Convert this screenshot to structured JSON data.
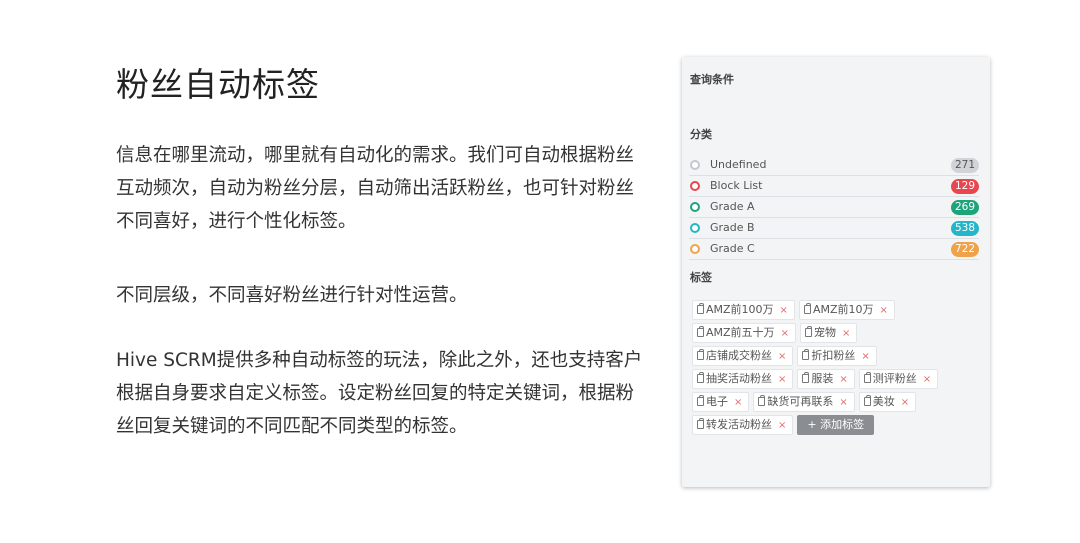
{
  "heading": "粉丝自动标签",
  "paragraphs": [
    "信息在哪里流动，哪里就有自动化的需求。我们可自动根据粉丝互动频次，自动为粉丝分层，自动筛出活跃粉丝，也可针对粉丝不同喜好，进行个性化标签。",
    "不同层级，不同喜好粉丝进行针对性运营。",
    "Hive SCRM提供多种自动标签的玩法，除此之外，还也支持客户根据自身要求自定义标签。设定粉丝回复的特定关键词，根据粉丝回复关键词的不同匹配不同类型的标签。"
  ],
  "panel": {
    "title": "查询条件",
    "category_title": "分类",
    "tags_title": "标签",
    "categories": [
      {
        "label": "Undefined",
        "count": "271",
        "color": "#d0d3d7",
        "icon_color": "#c4c8cc",
        "text_color": "#555555"
      },
      {
        "label": "Block List",
        "count": "129",
        "color": "#e8474f",
        "icon_color": "#e8474f",
        "text_color": "#ffffff"
      },
      {
        "label": "Grade A",
        "count": "269",
        "color": "#1fa37a",
        "icon_color": "#1fa37a",
        "text_color": "#ffffff"
      },
      {
        "label": "Grade B",
        "count": "538",
        "color": "#25b5c9",
        "icon_color": "#25b5c9",
        "text_color": "#ffffff"
      },
      {
        "label": "Grade C",
        "count": "722",
        "color": "#f0a24a",
        "icon_color": "#f0a24a",
        "text_color": "#ffffff"
      }
    ],
    "tag_rows": [
      [
        "AMZ前100万",
        "AMZ前10万"
      ],
      [
        "AMZ前五十万",
        "宠物"
      ],
      [
        "店铺成交粉丝",
        "折扣粉丝"
      ],
      [
        "抽奖活动粉丝",
        "服装",
        "测评粉丝"
      ],
      [
        "电子",
        "缺货可再联系",
        "美妆"
      ],
      [
        "转发活动粉丝"
      ]
    ],
    "remove_symbol": "×",
    "add_tag_label": "+ 添加标签"
  }
}
